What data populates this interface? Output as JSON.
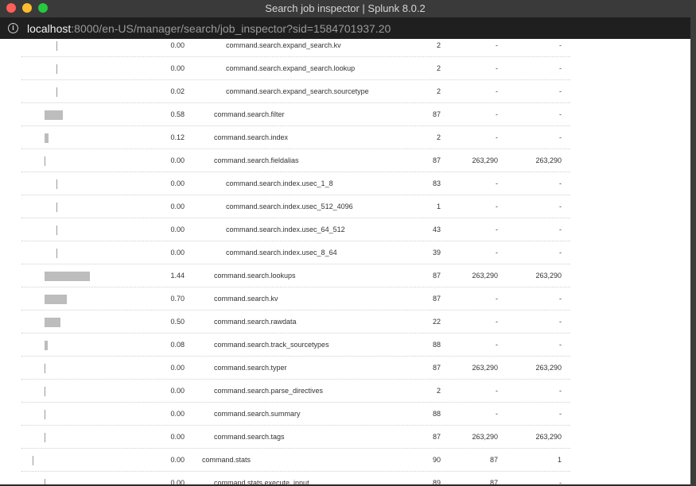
{
  "window": {
    "title": "Search job inspector | Splunk 8.0.2"
  },
  "address_bar": {
    "host": "localhost",
    "path": ":8000/en-US/manager/search/job_inspector?sid=1584701937.20"
  },
  "table": {
    "rows": [
      {
        "indent": 2,
        "duration": "0.00",
        "bar_fraction": 0.0,
        "component": "command.search.expand_search.kv",
        "invocations": "2",
        "input_count": "-",
        "output_count": "-"
      },
      {
        "indent": 2,
        "duration": "0.00",
        "bar_fraction": 0.0,
        "component": "command.search.expand_search.lookup",
        "invocations": "2",
        "input_count": "-",
        "output_count": "-"
      },
      {
        "indent": 2,
        "duration": "0.02",
        "bar_fraction": 0.0,
        "component": "command.search.expand_search.sourcetype",
        "invocations": "2",
        "input_count": "-",
        "output_count": "-"
      },
      {
        "indent": 1,
        "duration": "0.58",
        "bar_fraction": 0.4,
        "component": "command.search.filter",
        "invocations": "87",
        "input_count": "-",
        "output_count": "-"
      },
      {
        "indent": 1,
        "duration": "0.12",
        "bar_fraction": 0.08,
        "component": "command.search.index",
        "invocations": "2",
        "input_count": "-",
        "output_count": "-"
      },
      {
        "indent": 1,
        "duration": "0.00",
        "bar_fraction": 0.0,
        "component": "command.search.fieldalias",
        "invocations": "87",
        "input_count": "263,290",
        "output_count": "263,290"
      },
      {
        "indent": 2,
        "duration": "0.00",
        "bar_fraction": 0.0,
        "component": "command.search.index.usec_1_8",
        "invocations": "83",
        "input_count": "-",
        "output_count": "-"
      },
      {
        "indent": 2,
        "duration": "0.00",
        "bar_fraction": 0.0,
        "component": "command.search.index.usec_512_4096",
        "invocations": "1",
        "input_count": "-",
        "output_count": "-"
      },
      {
        "indent": 2,
        "duration": "0.00",
        "bar_fraction": 0.0,
        "component": "command.search.index.usec_64_512",
        "invocations": "43",
        "input_count": "-",
        "output_count": "-"
      },
      {
        "indent": 2,
        "duration": "0.00",
        "bar_fraction": 0.0,
        "component": "command.search.index.usec_8_64",
        "invocations": "39",
        "input_count": "-",
        "output_count": "-"
      },
      {
        "indent": 1,
        "duration": "1.44",
        "bar_fraction": 1.0,
        "component": "command.search.lookups",
        "invocations": "87",
        "input_count": "263,290",
        "output_count": "263,290"
      },
      {
        "indent": 1,
        "duration": "0.70",
        "bar_fraction": 0.49,
        "component": "command.search.kv",
        "invocations": "87",
        "input_count": "-",
        "output_count": "-"
      },
      {
        "indent": 1,
        "duration": "0.50",
        "bar_fraction": 0.35,
        "component": "command.search.rawdata",
        "invocations": "22",
        "input_count": "-",
        "output_count": "-"
      },
      {
        "indent": 1,
        "duration": "0.08",
        "bar_fraction": 0.06,
        "component": "command.search.track_sourcetypes",
        "invocations": "88",
        "input_count": "-",
        "output_count": "-"
      },
      {
        "indent": 1,
        "duration": "0.00",
        "bar_fraction": 0.0,
        "component": "command.search.typer",
        "invocations": "87",
        "input_count": "263,290",
        "output_count": "263,290"
      },
      {
        "indent": 1,
        "duration": "0.00",
        "bar_fraction": 0.0,
        "component": "command.search.parse_directives",
        "invocations": "2",
        "input_count": "-",
        "output_count": "-"
      },
      {
        "indent": 1,
        "duration": "0.00",
        "bar_fraction": 0.0,
        "component": "command.search.summary",
        "invocations": "88",
        "input_count": "-",
        "output_count": "-"
      },
      {
        "indent": 1,
        "duration": "0.00",
        "bar_fraction": 0.0,
        "component": "command.search.tags",
        "invocations": "87",
        "input_count": "263,290",
        "output_count": "263,290"
      },
      {
        "indent": 0,
        "duration": "0.00",
        "bar_fraction": 0.0,
        "component": "command.stats",
        "invocations": "90",
        "input_count": "87",
        "output_count": "1"
      },
      {
        "indent": 1,
        "duration": "0.00",
        "bar_fraction": 0.0,
        "component": "command.stats.execute_input",
        "invocations": "89",
        "input_count": "87",
        "output_count": "-"
      }
    ]
  },
  "colors": {
    "bar": "#bdbdbd",
    "separator": "#cfcfcf",
    "text": "#333333"
  }
}
